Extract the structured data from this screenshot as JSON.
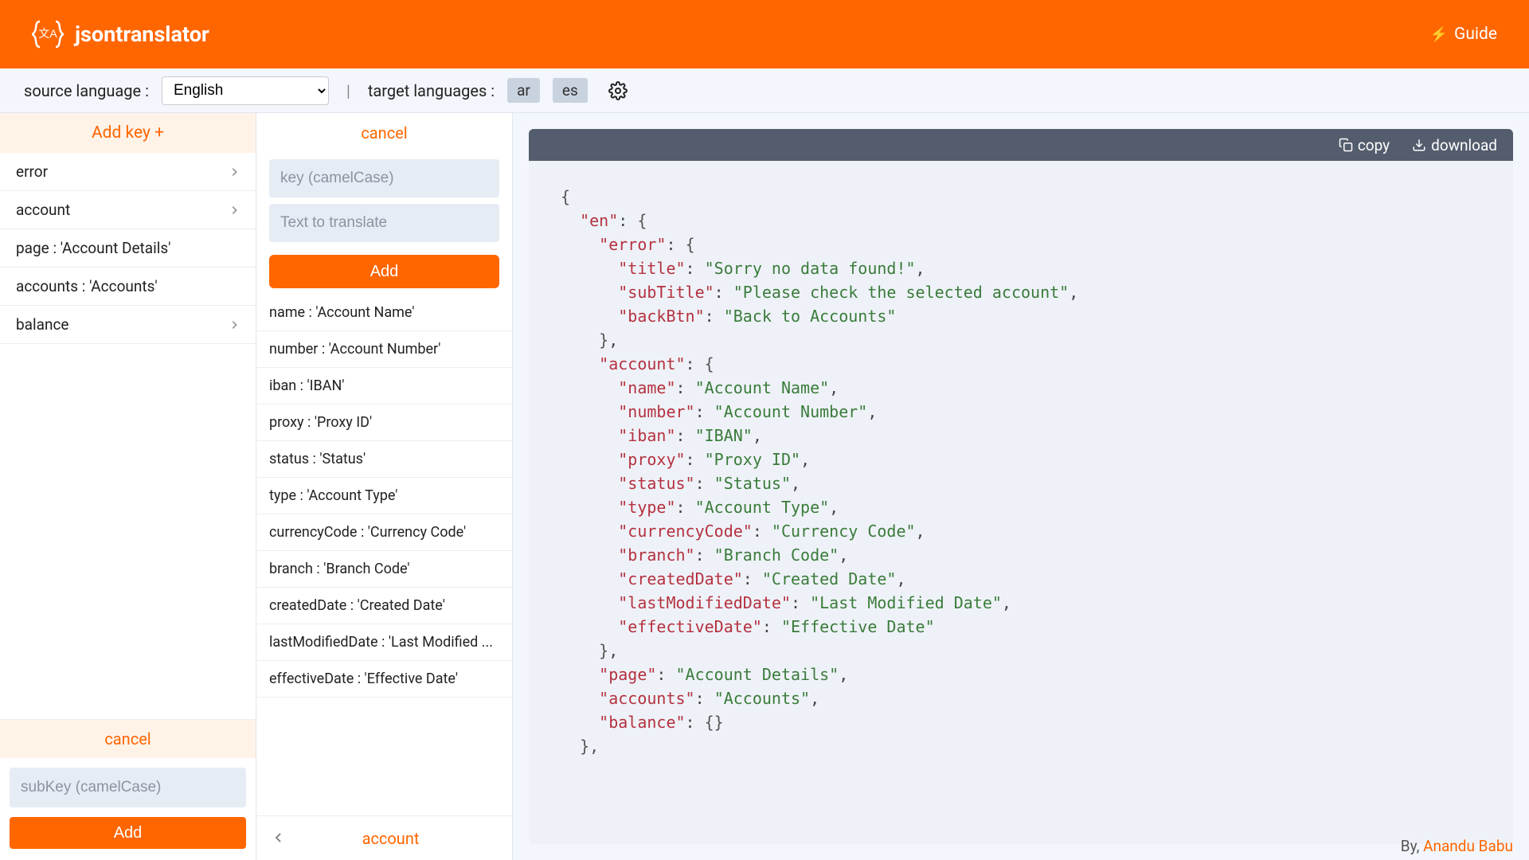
{
  "app": {
    "name": "jsontranslator"
  },
  "header": {
    "guide": "Guide"
  },
  "toolbar": {
    "src_label": "source language :",
    "src_selected": "English",
    "tgt_label": "target languages :",
    "tgt_langs": [
      "ar",
      "es"
    ]
  },
  "col1": {
    "header": "Add key +",
    "items": [
      {
        "label": "error",
        "type": "branch"
      },
      {
        "label": "account",
        "type": "branch"
      },
      {
        "label": "page : 'Account Details'",
        "type": "leaf"
      },
      {
        "label": "accounts : 'Accounts'",
        "type": "leaf"
      },
      {
        "label": "balance",
        "type": "branch"
      }
    ],
    "cancel": "cancel",
    "subkey_placeholder": "subKey (camelCase)",
    "add": "Add"
  },
  "col2": {
    "cancel": "cancel",
    "key_placeholder": "key (camelCase)",
    "text_placeholder": "Text to translate",
    "add": "Add",
    "items": [
      "name : 'Account Name'",
      "number : 'Account Number'",
      "iban : 'IBAN'",
      "proxy : 'Proxy ID'",
      "status : 'Status'",
      "type : 'Account Type'",
      "currencyCode : 'Currency Code'",
      "branch : 'Branch Code'",
      "createdDate : 'Created Date'",
      "lastModifiedDate : 'Last Modified ...",
      "effectiveDate : 'Effective Date'"
    ],
    "crumb": "account"
  },
  "code": {
    "copy": "copy",
    "download": "download",
    "json": {
      "en": {
        "error": {
          "title": "Sorry no data found!",
          "subTitle": "Please check the selected account",
          "backBtn": "Back to Accounts"
        },
        "account": {
          "name": "Account Name",
          "number": "Account Number",
          "iban": "IBAN",
          "proxy": "Proxy ID",
          "status": "Status",
          "type": "Account Type",
          "currencyCode": "Currency Code",
          "branch": "Branch Code",
          "createdDate": "Created Date",
          "lastModifiedDate": "Last Modified Date",
          "effectiveDate": "Effective Date"
        },
        "page": "Account Details",
        "accounts": "Accounts",
        "balance": {}
      }
    }
  },
  "footer": {
    "by": "By,",
    "author": "Anandu Babu"
  }
}
